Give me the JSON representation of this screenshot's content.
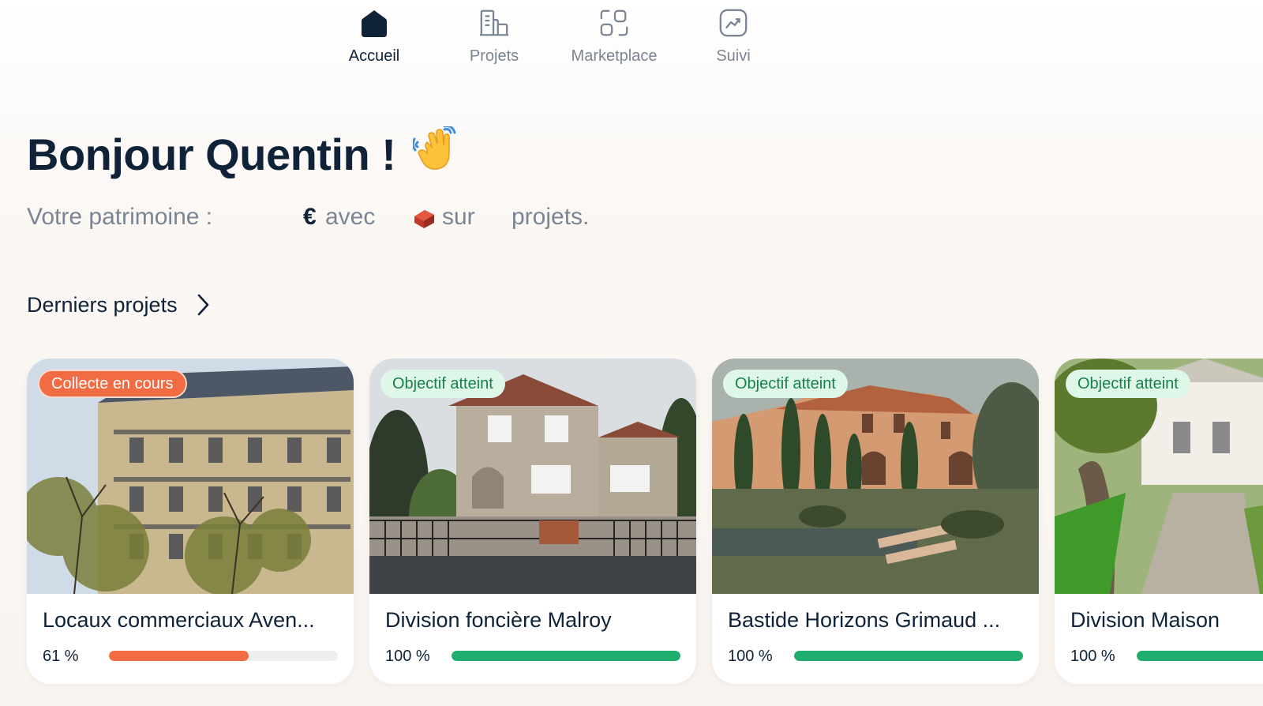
{
  "nav": {
    "items": [
      {
        "label": "Accueil",
        "icon": "home-icon",
        "active": true
      },
      {
        "label": "Projets",
        "icon": "buildings-icon",
        "active": false
      },
      {
        "label": "Marketplace",
        "icon": "marketplace-icon",
        "active": false
      },
      {
        "label": "Suivi",
        "icon": "chart-trend-icon",
        "active": false
      }
    ]
  },
  "greeting": {
    "text": "Bonjour Quentin !",
    "emoji_icon": "waving-hand-icon"
  },
  "wealth": {
    "label": "Votre patrimoine :",
    "currency": "€",
    "avec": "avec",
    "brick_icon": "brick-icon",
    "sur": "sur",
    "projets": "projets."
  },
  "section": {
    "title": "Derniers projets",
    "chevron_icon": "chevron-right-icon"
  },
  "colors": {
    "primary_text": "#0f2238",
    "muted_text": "#7a8493",
    "progress_orange": "#f26c43",
    "progress_green": "#1fae6e"
  },
  "projects": [
    {
      "badge": "Collecte en cours",
      "badge_style": "orange",
      "title": "Locaux commerciaux Aven...",
      "percent_label": "61 %",
      "progress": 0.61,
      "bar_color": "#f26c43"
    },
    {
      "badge": "Objectif atteint",
      "badge_style": "green",
      "title": "Division foncière Malroy",
      "percent_label": "100 %",
      "progress": 1.0,
      "bar_color": "#1fae6e"
    },
    {
      "badge": "Objectif atteint",
      "badge_style": "green",
      "title": "Bastide Horizons Grimaud ...",
      "percent_label": "100 %",
      "progress": 1.0,
      "bar_color": "#1fae6e"
    },
    {
      "badge": "Objectif atteint",
      "badge_style": "green",
      "title": "Division Maison",
      "percent_label": "100 %",
      "progress": 1.0,
      "bar_color": "#1fae6e"
    }
  ]
}
